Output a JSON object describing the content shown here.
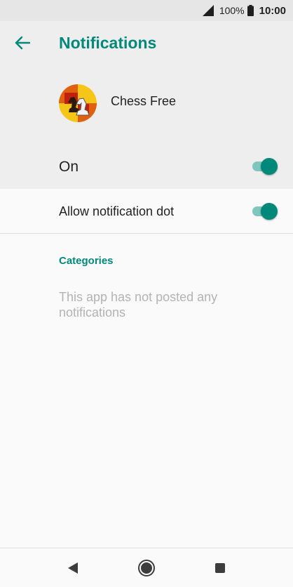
{
  "status_bar": {
    "battery": "100%",
    "time": "10:00",
    "icons": [
      "signal-icon",
      "battery-icon"
    ]
  },
  "header": {
    "title": "Notifications",
    "back_icon": "arrow-left-icon",
    "app_name": "Chess Free",
    "app_icon": "chess-knight-icon",
    "master_label": "On",
    "master_on": true
  },
  "settings": {
    "allow_dot_label": "Allow notification dot",
    "allow_dot_on": true,
    "categories_header": "Categories",
    "empty_message": "This app has not posted any notifications"
  },
  "nav_bar": {
    "icons": [
      "back-triangle-icon",
      "home-circle-icon",
      "recents-square-icon"
    ]
  },
  "colors": {
    "accent": "#00897b",
    "accent_track": "#7fc6bd",
    "header_bg": "#eeeeee",
    "status_bg": "#e6e6e6",
    "muted_text": "#b3b3b3"
  }
}
